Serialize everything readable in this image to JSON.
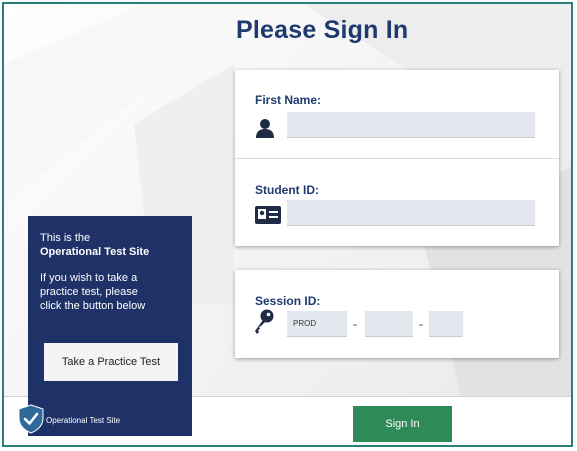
{
  "page": {
    "title": "Please Sign In"
  },
  "form": {
    "first_name_label": "First Name:",
    "first_name_value": "",
    "student_id_label": "Student ID:",
    "student_id_value": "",
    "session_label": "Session ID:",
    "session_prefix": "PROD",
    "session_part2": "",
    "session_part3": "",
    "separator": "-"
  },
  "actions": {
    "sign_in_label": "Sign In",
    "practice_label": "Take a Practice Test"
  },
  "info": {
    "line1": "This is the",
    "line2": "Operational Test Site",
    "line3": "If you wish to take a",
    "line4": "practice test, please",
    "line5": "click the button below",
    "footer_label": "Operational Test Site"
  },
  "icons": {
    "user": "user-icon",
    "id_card": "id-card-icon",
    "key": "key-icon",
    "shield": "shield-check-icon"
  },
  "colors": {
    "title": "#1f3a6e",
    "panel": "#1f3268",
    "sign_in": "#2e8b57",
    "frame": "#2a7e7a"
  }
}
